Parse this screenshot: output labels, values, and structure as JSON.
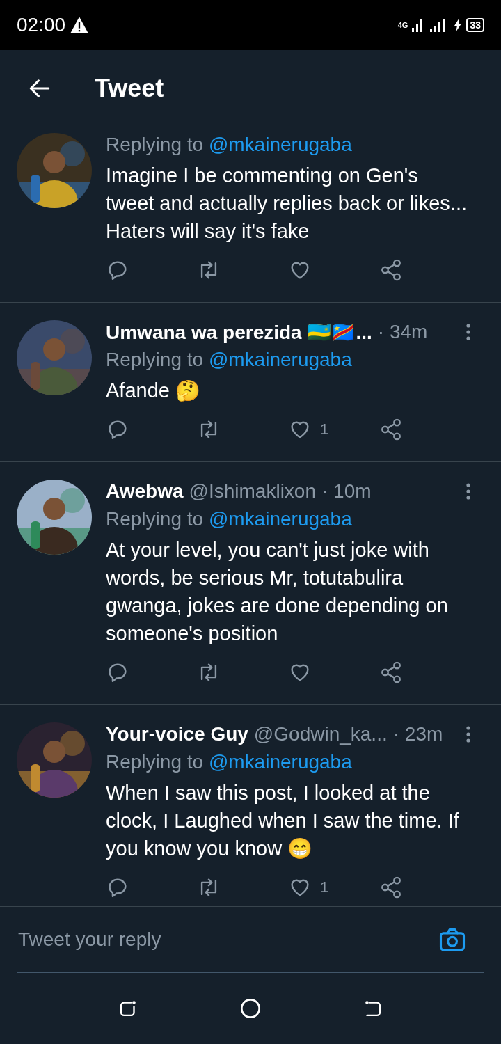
{
  "status_bar": {
    "time": "02:00",
    "network": "4G",
    "battery": "33"
  },
  "header": {
    "title": "Tweet"
  },
  "tweets": [
    {
      "replying_label": "Replying to",
      "replying_to": "@mkainerugaba",
      "text": "Imagine I be commenting on Gen's tweet and actually replies back or likes... Haters will say it's fake"
    },
    {
      "name": "Umwana wa perezida 🇷🇼🇨🇩...",
      "time": "· 34m",
      "replying_label": "Replying to",
      "replying_to": "@mkainerugaba",
      "text": "Afande 🤔",
      "likes": "1"
    },
    {
      "name": "Awebwa",
      "handle": "@Ishimaklixon",
      "time": "· 10m",
      "replying_label": "Replying to",
      "replying_to": "@mkainerugaba",
      "text": "At your level, you can't just joke with words, be serious Mr, totutabulira gwanga, jokes are done depending on someone's position"
    },
    {
      "name": "Your-voice Guy",
      "handle": "@Godwin_ka...",
      "time": "· 23m",
      "replying_label": "Replying to",
      "replying_to": "@mkainerugaba",
      "text": "When I saw this post, I looked at the clock, I Laughed when I saw the time. If you know you know 😁",
      "likes": "1"
    }
  ],
  "reply_bar": {
    "placeholder": "Tweet your reply"
  }
}
